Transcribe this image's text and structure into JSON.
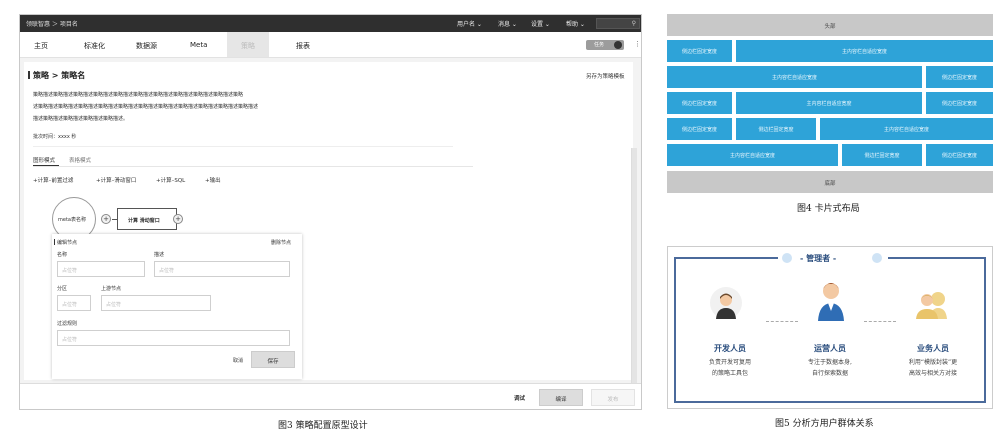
{
  "fig3": {
    "caption": "图3 策略配置原型设计",
    "topbar": {
      "brand": "领联智惠  ＞ 项目名",
      "menus": [
        "用户名 ⌄",
        "消息 ⌄",
        "设置 ⌄",
        "帮助 ⌄"
      ]
    },
    "nav": {
      "items": [
        "主页",
        "标准化",
        "数据源",
        "Meta",
        "策略",
        "报表"
      ],
      "active_index": 4,
      "pill_label": "任务",
      "more_icon": "⋮"
    },
    "page": {
      "title": "策略 > 策略名",
      "save_template": "另存为策略模板",
      "description": [
        "策略描述策略描述策略描述策略描述策略描述策略描述策略描述策略描述策略描述策略描述策略",
        "述策略描述策略描述策略描述策略描述策略描述策略描述策略描述策略描述策略描述策略描述策略描述",
        "描述策略描述策略描述策略描述策略描述。"
      ],
      "batch_time": "批次时间：xxxx 秒",
      "tabs": [
        "图形模式",
        "表格模式"
      ],
      "actions": [
        "+计算–前置过滤",
        "+计算–滑动窗口",
        "+计算–SQL",
        "+输出"
      ],
      "node_meta": "meta表名称",
      "node_calc": "计算 滑动窗口",
      "edit_node": "编辑节点",
      "delete_node": "删除节点",
      "fields": {
        "name_label": "名称",
        "desc_label": "描述",
        "partition_label": "分区",
        "upstream_label": "上游节点",
        "filter_label": "过滤规则",
        "placeholder": "占位符"
      },
      "cancel": "取消",
      "save": "保存",
      "debug": "调试",
      "compile": "编译",
      "publish": "发布"
    }
  },
  "fig4": {
    "caption": "图4 卡片式布局",
    "header": "头部",
    "footer": "底部",
    "fixed": "侧边栏固定宽度",
    "adaptive": "主内容栏自适应宽度"
  },
  "fig5": {
    "caption": "图5 分析方用户群体关系",
    "manager": "- 管理者 -",
    "roles": [
      {
        "name": "开发人员",
        "desc1": "负责开发可复用",
        "desc2": "的策略工具包"
      },
      {
        "name": "运营人员",
        "desc1": "专注于数据本身,",
        "desc2": "自行探索数据"
      },
      {
        "name": "业务人员",
        "desc1": "利用“模版封装”更",
        "desc2": "高效与相关方对接"
      }
    ],
    "colors": {
      "accent": "#2ea3d8",
      "frame": "#4b6a9b"
    }
  }
}
